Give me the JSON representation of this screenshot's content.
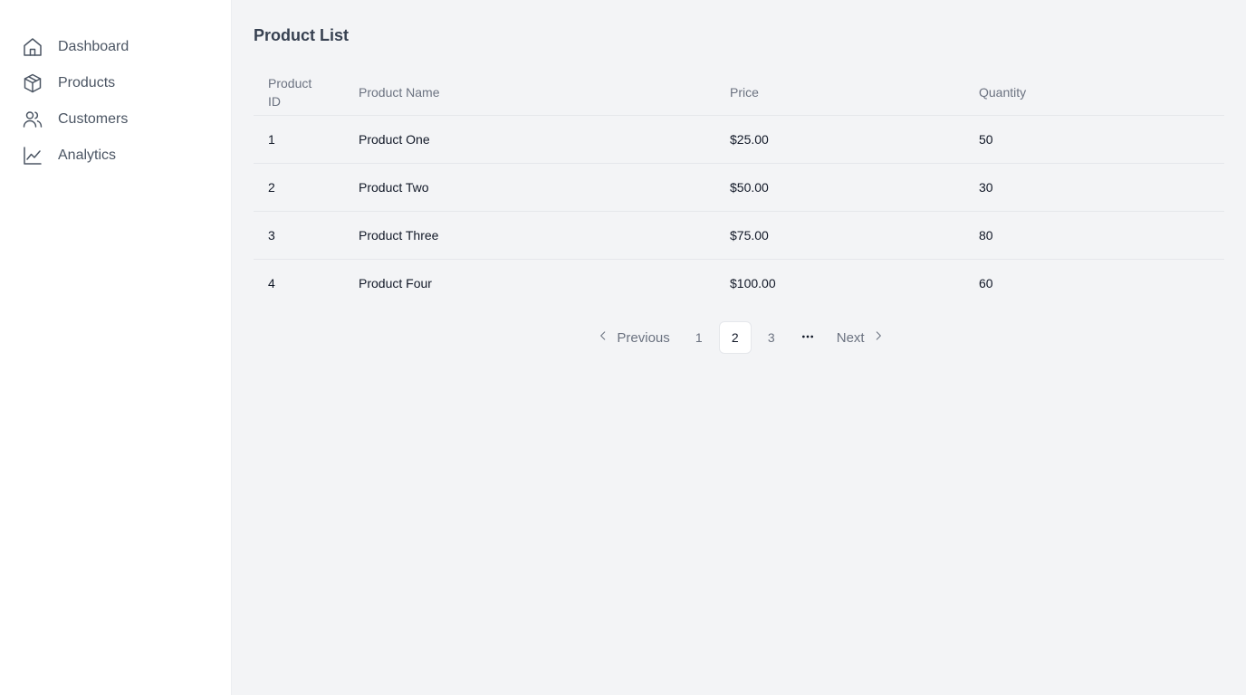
{
  "sidebar": {
    "items": [
      {
        "label": "Dashboard",
        "icon": "home-icon"
      },
      {
        "label": "Products",
        "icon": "package-icon"
      },
      {
        "label": "Customers",
        "icon": "users-icon"
      },
      {
        "label": "Analytics",
        "icon": "line-chart-icon"
      }
    ]
  },
  "main": {
    "title": "Product List",
    "table": {
      "headers": [
        "Product ID",
        "Product Name",
        "Price",
        "Quantity"
      ],
      "rows": [
        {
          "id": "1",
          "name": "Product One",
          "price": "$25.00",
          "quantity": "50"
        },
        {
          "id": "2",
          "name": "Product Two",
          "price": "$50.00",
          "quantity": "30"
        },
        {
          "id": "3",
          "name": "Product Three",
          "price": "$75.00",
          "quantity": "80"
        },
        {
          "id": "4",
          "name": "Product Four",
          "price": "$100.00",
          "quantity": "60"
        }
      ]
    },
    "pagination": {
      "previous_label": "Previous",
      "next_label": "Next",
      "pages": [
        "1",
        "2",
        "3"
      ],
      "current_page": "2",
      "ellipsis_icon": "more-horizontal-icon"
    }
  }
}
